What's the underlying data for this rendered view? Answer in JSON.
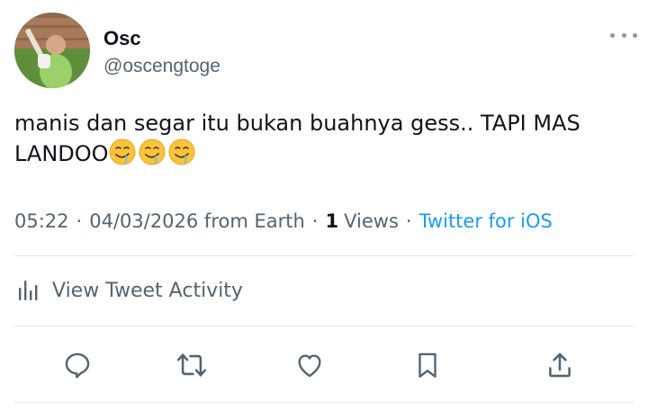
{
  "user": {
    "display_name": "Osc",
    "handle": "@oscengtoge"
  },
  "tweet": {
    "text": "manis dan segar itu bukan buahnya gess.. TAPI MAS LANDOO",
    "emojis": [
      "drooling-face",
      "drooling-face",
      "drooling-face"
    ]
  },
  "meta": {
    "time": "05:22",
    "date": "04/03/2026 from Earth",
    "views_count": "1",
    "views_label": "Views",
    "source": "Twitter for iOS",
    "separator": "·"
  },
  "activity": {
    "label": "View Tweet Activity"
  },
  "icons": {
    "more": "more-horizontal-icon",
    "activity": "bar-chart-icon",
    "actions": [
      "reply-icon",
      "retweet-icon",
      "like-icon",
      "bookmark-icon",
      "share-icon"
    ]
  },
  "colors": {
    "text": "#0f1419",
    "secondary": "#536471",
    "link": "#1d9bf0",
    "divider": "#e1e8ed",
    "icon": "#536471"
  }
}
